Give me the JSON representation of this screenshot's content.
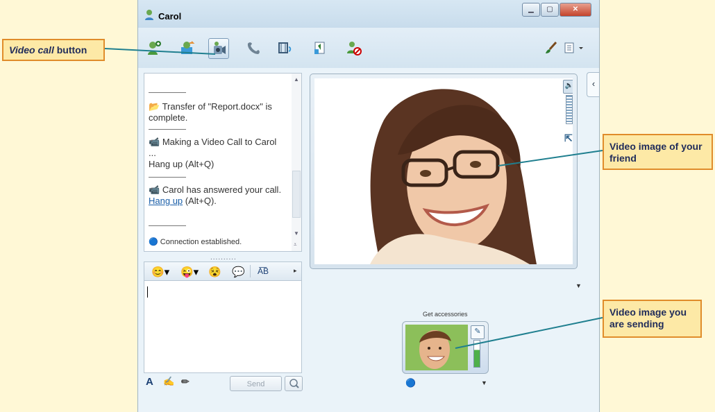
{
  "window": {
    "title": "Carol",
    "controls": [
      "minimize",
      "maximize",
      "close"
    ]
  },
  "toolbar": {
    "buttons": [
      {
        "name": "invite-someone",
        "icon": "add-contact-icon"
      },
      {
        "name": "share-folders",
        "icon": "share-icon"
      },
      {
        "name": "video-call",
        "icon": "video-call-icon",
        "active": true
      },
      {
        "name": "call",
        "icon": "phone-icon"
      },
      {
        "name": "activities",
        "icon": "activities-icon"
      },
      {
        "name": "games",
        "icon": "games-icon"
      },
      {
        "name": "block",
        "icon": "block-contact-icon"
      }
    ]
  },
  "conversation": {
    "messages": [
      {
        "icon": "folder-icon",
        "text": "Transfer of \"Report.docx\" is complete."
      },
      {
        "icon": "video-call-icon",
        "text": "Making a Video Call to Carol ...",
        "sub": "Hang up (Alt+Q)"
      },
      {
        "icon": "video-call-icon",
        "text": "Carol has answered your call.",
        "link": "Hang up",
        "link_suffix": " (Alt+Q)."
      }
    ],
    "status": "Connection established.",
    "grip": ".........."
  },
  "compose": {
    "send_label": "Send"
  },
  "video": {
    "accessories_label": "Get accessories"
  },
  "callouts": {
    "video_call": {
      "italic": "Video call",
      "rest": " button"
    },
    "friend": "Video image of your friend",
    "sending": "Video image you are sending"
  },
  "colors": {
    "callout_fill": "#fde9a6",
    "callout_border": "#e08c2a",
    "leader_line": "#1f7f8f",
    "background": "#fff8d6"
  }
}
